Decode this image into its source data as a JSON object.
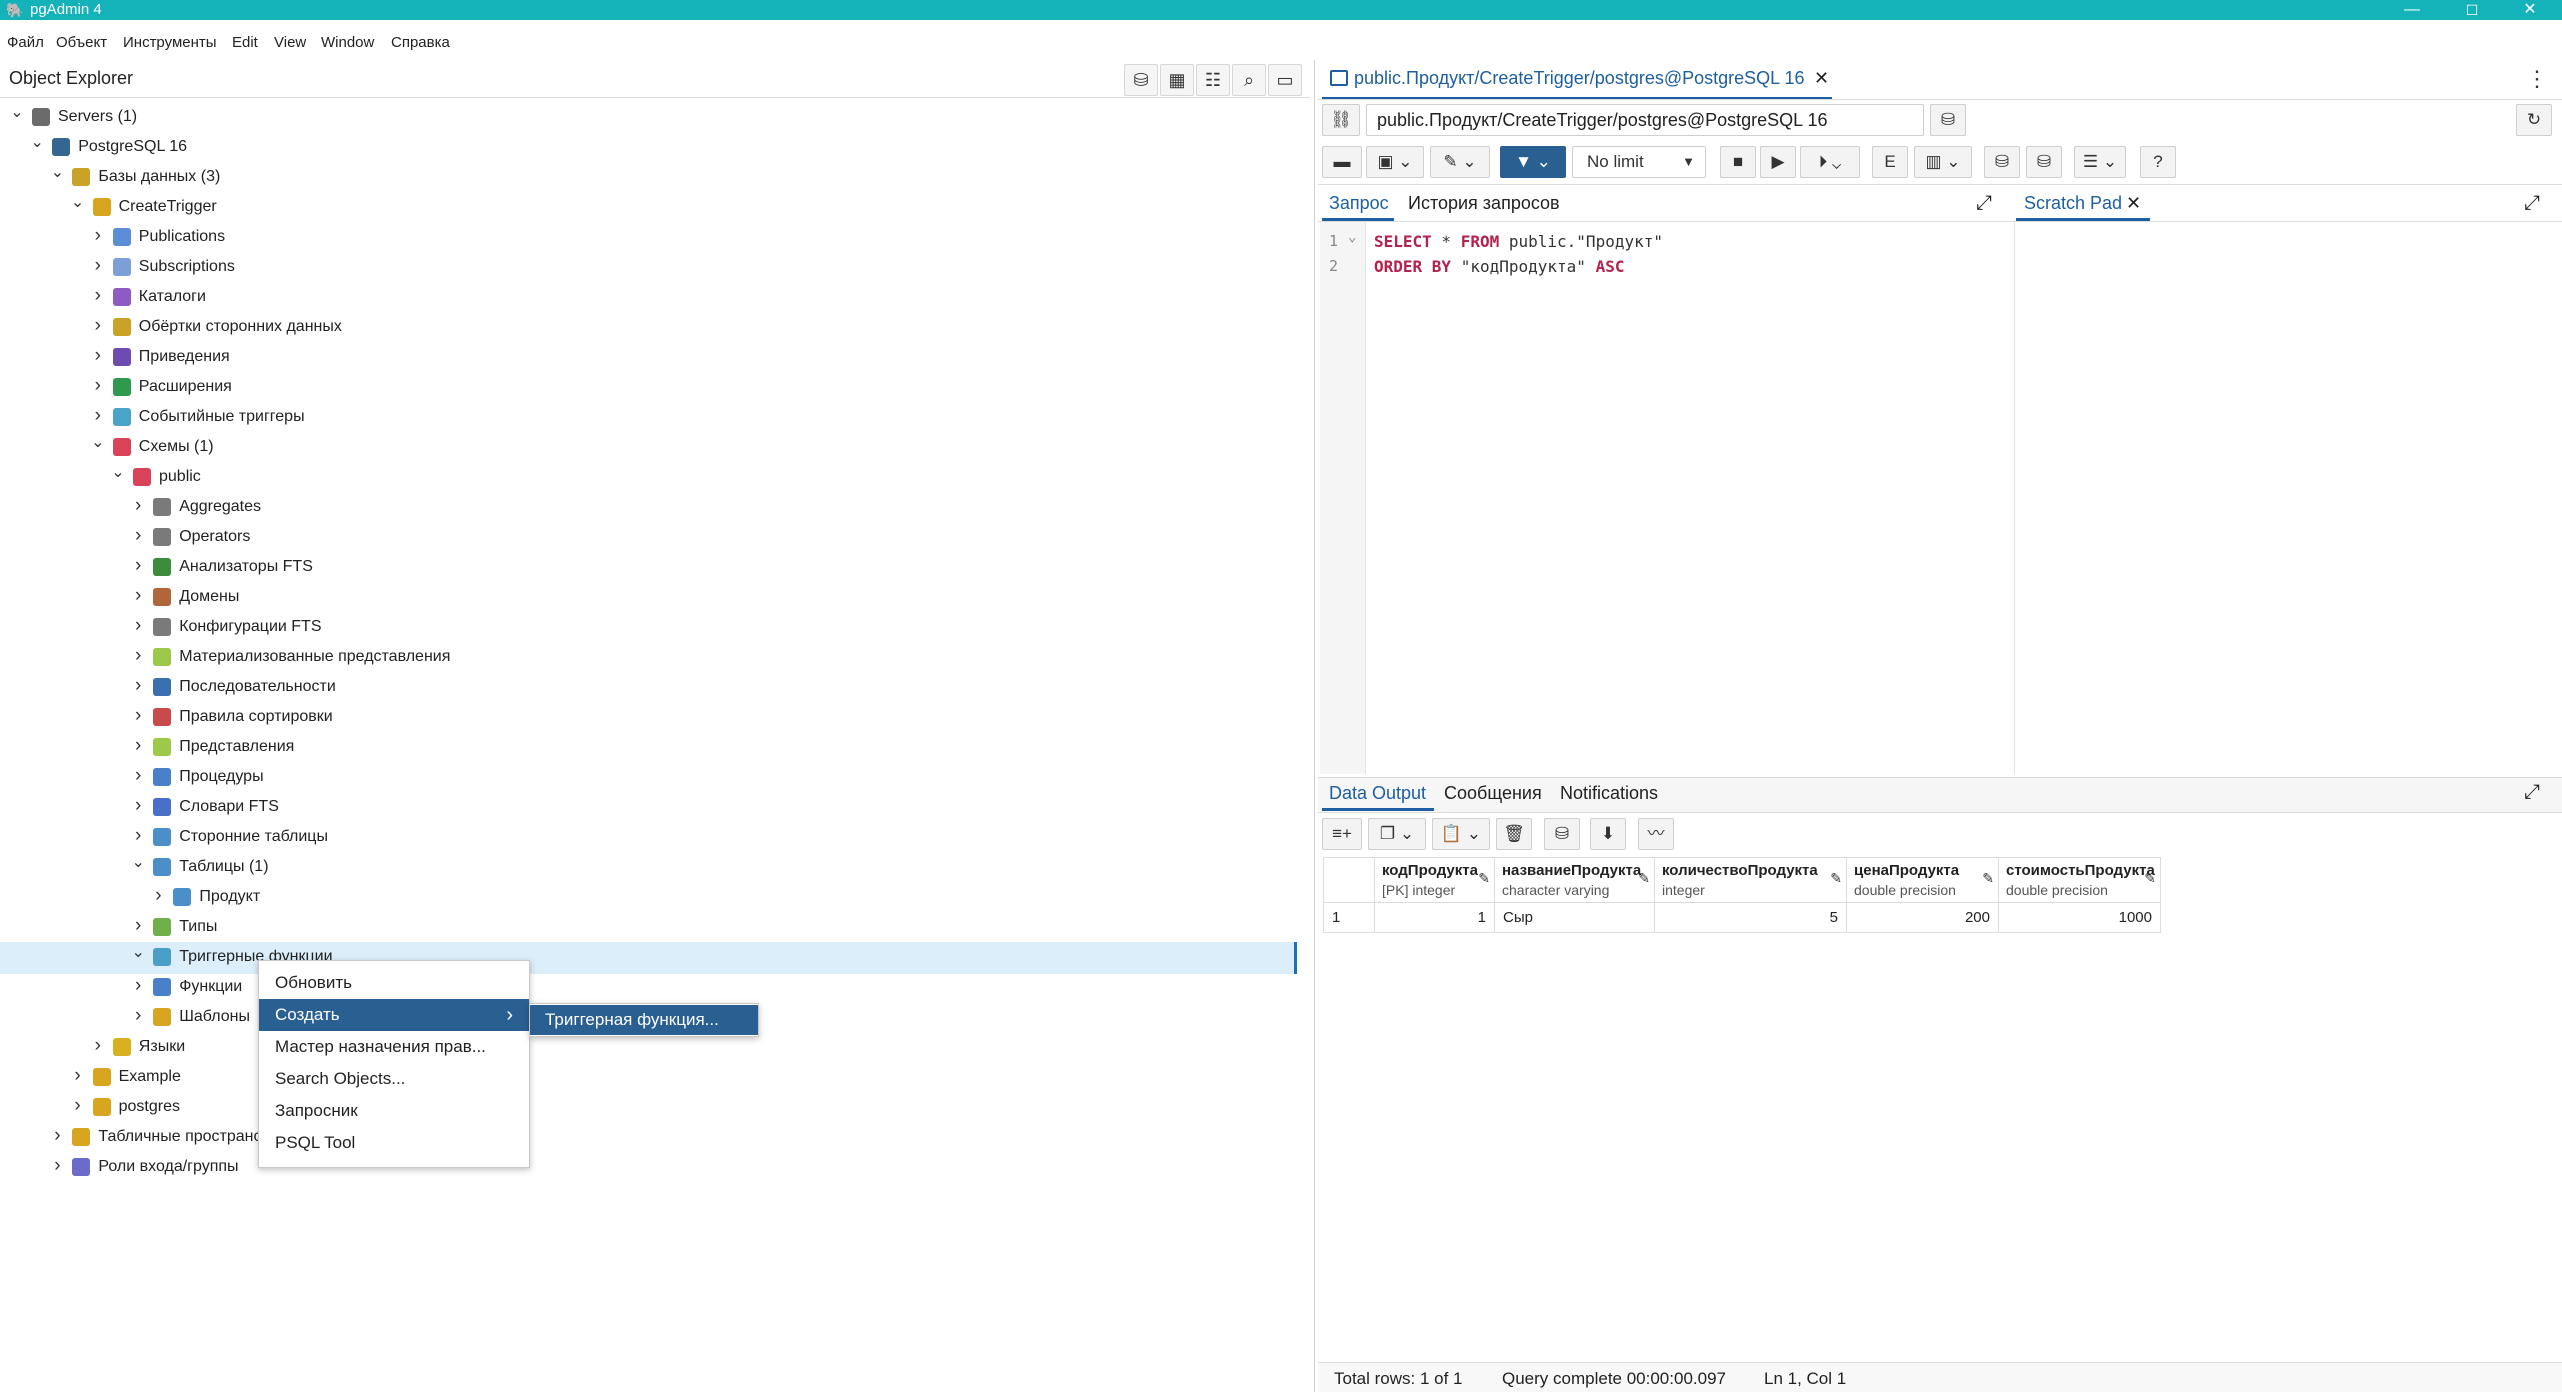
{
  "window": {
    "title": "pgAdmin 4",
    "minimize": "—",
    "maximize": "☐",
    "close": "✕"
  },
  "menu": [
    "Файл",
    "Объект",
    "Инструменты",
    "Edit",
    "View",
    "Window",
    "Справка"
  ],
  "object_explorer": {
    "title": "Object Explorer",
    "toolbar_icons": [
      "query-tool-icon",
      "view-data-icon",
      "filtered-rows-icon",
      "search-icon",
      "psql-icon"
    ]
  },
  "tree": [
    {
      "label": "Servers (1)",
      "depth": 0,
      "expanded": true,
      "icon": "servers-icon",
      "color": "#6b6b6b"
    },
    {
      "label": "PostgreSQL 16",
      "depth": 1,
      "expanded": true,
      "icon": "elephant-icon",
      "color": "#336791"
    },
    {
      "label": "Базы данных (3)",
      "depth": 2,
      "expanded": true,
      "icon": "databases-icon",
      "color": "#c9a227"
    },
    {
      "label": "CreateTrigger",
      "depth": 3,
      "expanded": true,
      "icon": "database-icon",
      "color": "#d8a520"
    },
    {
      "label": "Publications",
      "depth": 4,
      "expanded": false,
      "icon": "publication-icon",
      "color": "#5b8ed6"
    },
    {
      "label": "Subscriptions",
      "depth": 4,
      "expanded": false,
      "icon": "subscription-icon",
      "color": "#7b9fd6"
    },
    {
      "label": "Каталоги",
      "depth": 4,
      "expanded": false,
      "icon": "catalog-icon",
      "color": "#8e5bc4"
    },
    {
      "label": "Обёртки сторонних данных",
      "depth": 4,
      "expanded": false,
      "icon": "fdw-icon",
      "color": "#c9a227"
    },
    {
      "label": "Приведения",
      "depth": 4,
      "expanded": false,
      "icon": "cast-icon",
      "color": "#6d4bb0"
    },
    {
      "label": "Расширения",
      "depth": 4,
      "expanded": false,
      "icon": "extension-icon",
      "color": "#2f9a4e"
    },
    {
      "label": "Событийные триггеры",
      "depth": 4,
      "expanded": false,
      "icon": "event-trigger-icon",
      "color": "#4aa3c9"
    },
    {
      "label": "Схемы (1)",
      "depth": 4,
      "expanded": true,
      "icon": "schemas-icon",
      "color": "#d9435a"
    },
    {
      "label": "public",
      "depth": 5,
      "expanded": true,
      "icon": "schema-icon",
      "color": "#d9435a"
    },
    {
      "label": "Aggregates",
      "depth": 6,
      "expanded": false,
      "icon": "aggregate-icon",
      "color": "#7a7a7a"
    },
    {
      "label": "Operators",
      "depth": 6,
      "expanded": false,
      "icon": "operator-icon",
      "color": "#7a7a7a"
    },
    {
      "label": "Анализаторы FTS",
      "depth": 6,
      "expanded": false,
      "icon": "fts-parser-icon",
      "color": "#3d8b3d"
    },
    {
      "label": "Домены",
      "depth": 6,
      "expanded": false,
      "icon": "domain-icon",
      "color": "#b0663a"
    },
    {
      "label": "Конфигурации FTS",
      "depth": 6,
      "expanded": false,
      "icon": "fts-config-icon",
      "color": "#7a7a7a"
    },
    {
      "label": "Материализованные представления",
      "depth": 6,
      "expanded": false,
      "icon": "mview-icon",
      "color": "#9cc94a"
    },
    {
      "label": "Последовательности",
      "depth": 6,
      "expanded": false,
      "icon": "sequence-icon",
      "color": "#3a6fb0"
    },
    {
      "label": "Правила сортировки",
      "depth": 6,
      "expanded": false,
      "icon": "collation-icon",
      "color": "#c94a4a"
    },
    {
      "label": "Представления",
      "depth": 6,
      "expanded": false,
      "icon": "view-icon",
      "color": "#9cc94a"
    },
    {
      "label": "Процедуры",
      "depth": 6,
      "expanded": false,
      "icon": "procedure-icon",
      "color": "#4a7fc9"
    },
    {
      "label": "Словари FTS",
      "depth": 6,
      "expanded": false,
      "icon": "fts-dictionary-icon",
      "color": "#4a6fc9"
    },
    {
      "label": "Сторонние таблицы",
      "depth": 6,
      "expanded": false,
      "icon": "foreign-table-icon",
      "color": "#4a8fc9"
    },
    {
      "label": "Таблицы (1)",
      "depth": 6,
      "expanded": true,
      "icon": "tables-icon",
      "color": "#4a8fc9"
    },
    {
      "label": "Продукт",
      "depth": 7,
      "expanded": false,
      "icon": "table-icon",
      "color": "#4a8fc9"
    },
    {
      "label": "Типы",
      "depth": 6,
      "expanded": false,
      "icon": "type-icon",
      "color": "#6fb04a"
    },
    {
      "label": "Триггерные функции",
      "depth": 6,
      "expanded": true,
      "icon": "trigger-function-icon",
      "color": "#4a9fc9"
    },
    {
      "label": "Функции",
      "depth": 6,
      "expanded": false,
      "icon": "function-icon",
      "color": "#4a7fc9"
    },
    {
      "label": "Шаблоны",
      "depth": 6,
      "expanded": false,
      "icon": "fts-template-icon",
      "color": "#d8a520"
    },
    {
      "label": "Языки",
      "depth": 4,
      "expanded": false,
      "icon": "language-icon",
      "color": "#d8b020"
    },
    {
      "label": "Example",
      "depth": 3,
      "expanded": false,
      "icon": "database-icon",
      "color": "#d8a520"
    },
    {
      "label": "postgres",
      "depth": 3,
      "expanded": false,
      "icon": "database-icon",
      "color": "#d8a520"
    },
    {
      "label": "Табличные пространства",
      "depth": 2,
      "expanded": false,
      "icon": "tablespace-icon",
      "color": "#d8a520"
    },
    {
      "label": "Роли входа/группы",
      "depth": 2,
      "expanded": false,
      "icon": "roles-icon",
      "color": "#6b6bc9"
    }
  ],
  "context_menu": {
    "items": [
      "Обновить",
      "Создать",
      "Мастер назначения прав...",
      "Search Objects...",
      "Запросник",
      "PSQL Tool"
    ],
    "active_index": 1,
    "submenu_arrow": "›",
    "submenu": [
      "Триггерная функция..."
    ]
  },
  "query_tab": {
    "title": "public.Продукт/CreateTrigger/postgres@PostgreSQL 16",
    "close": "✕",
    "more": "⋮"
  },
  "query_toolbar": {
    "connection": "public.Продукт/CreateTrigger/postgres@PostgreSQL 16",
    "limit": "No limit"
  },
  "editor_tabs": {
    "query": "Запрос",
    "history": "История запросов",
    "scratch": "Scratch Pad",
    "scratch_close": "✕"
  },
  "sql_lines": [
    {
      "num": "1",
      "parts": [
        {
          "t": "SELECT",
          "k": true
        },
        {
          "t": " * ",
          "k": false
        },
        {
          "t": "FROM",
          "k": true
        },
        {
          "t": " public.\"Продукт\"",
          "k": false
        }
      ]
    },
    {
      "num": "2",
      "parts": [
        {
          "t": "ORDER BY",
          "k": true
        },
        {
          "t": " \"кодПродукта\" ",
          "k": false
        },
        {
          "t": "ASC",
          "k": true
        }
      ]
    }
  ],
  "output_tabs": [
    "Data Output",
    "Сообщения",
    "Notifications"
  ],
  "grid": {
    "columns": [
      {
        "name": "кодПродукта",
        "type": "[PK] integer"
      },
      {
        "name": "названиеПродукта",
        "type": "character varying"
      },
      {
        "name": "количествоПродукта",
        "type": "integer"
      },
      {
        "name": "ценаПродукта",
        "type": "double precision"
      },
      {
        "name": "стоимостьПродукта",
        "type": "double precision"
      }
    ],
    "rows": [
      {
        "n": "1",
        "cells": [
          "1",
          "Сыр",
          "5",
          "200",
          "1000"
        ]
      }
    ]
  },
  "status": {
    "total": "Total rows: 1 of 1",
    "query": "Query complete 00:00:00.097",
    "pos": "Ln 1, Col 1"
  }
}
